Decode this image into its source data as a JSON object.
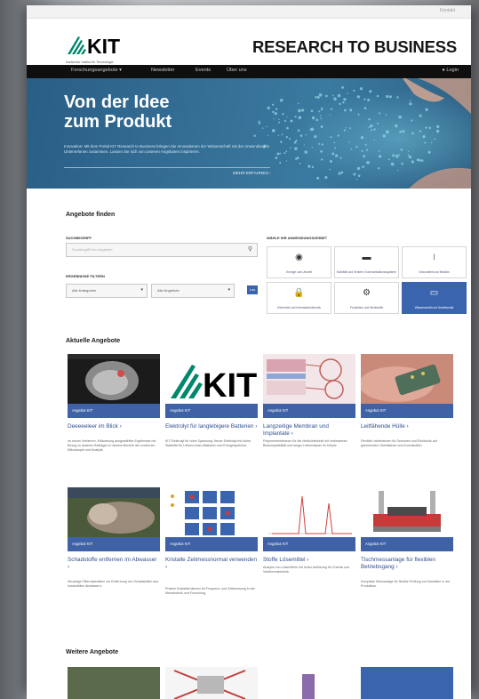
{
  "topbar": {
    "link": "Kontakt"
  },
  "header": {
    "logo_text": "KIT",
    "logo_sub": "Karlsruher Institut für Technologie",
    "site_title": "RESEARCH TO BUSINESS"
  },
  "nav": {
    "items": [
      "Forschungsangebote ▾",
      "Newsletter",
      "Events",
      "Über uns"
    ],
    "login": "Login"
  },
  "hero": {
    "heading_line1": "Von der Idee",
    "heading_line2": "zum Produkt",
    "text": "Innovation: Mit dem Portal KIT Research to Business bringen Sie Innovationen der Wissenschaft mit der Anwendung in Unternehmen zusammen. Lassen Sie sich von unseren Angeboten inspirieren.",
    "more": "MEHR ERFAHREN  ›"
  },
  "search": {
    "title": "Angebote finden",
    "keyword_label": "SUCHBEGRIFF",
    "keyword_placeholder": "Suchbegriff hier eingeben",
    "filter_label": "ERGEBNISSE FILTERN",
    "select1": "Alle Kategorien",
    "select2": "Alle Angebote",
    "go": "Los"
  },
  "areas": {
    "label": "WÄHLE IHR ANWENDUNGSGEBIET",
    "tiles": [
      {
        "icon": "globe-icon",
        "glyph": "◉",
        "label": "Energie und Umwelt",
        "active": false
      },
      {
        "icon": "car-icon",
        "glyph": "▬",
        "label": "Mobilität und Verkehr, Kommunikationssysteme",
        "active": false
      },
      {
        "icon": "dna-icon",
        "glyph": "⧘",
        "label": "Gesundheit und Medizin",
        "active": false
      },
      {
        "icon": "lock-icon",
        "glyph": "🔒",
        "label": "Sicherheit und Informationstechnik",
        "active": false
      },
      {
        "icon": "gears-icon",
        "glyph": "⚙",
        "label": "Produktion und Werkstoffe",
        "active": false
      },
      {
        "icon": "chat-icon",
        "glyph": "▭",
        "label": "Wissenschaft und Gesellschaft",
        "active": true
      }
    ]
  },
  "offers": {
    "title": "Aktuelle Angebote",
    "cards": [
      {
        "tag": "Angebot KIT",
        "title": "Deeeeeleer im Blick ›",
        "desc": "Im neuen Verfahren. Erläuterung ausgewählter Ergebnisse mit Bezug zu anderen Beiträgen in diesem Bereich der modernen Mikroskopie und Analytik."
      },
      {
        "tag": "Angebot KIT",
        "title": "Elektrolyt für langlebigere Batterien ›",
        "desc": "KIT Elektrolyt für hohe Spannung: Neuer Elektrolyt mit hoher Stabilität für Lithium-Ionen-Batterien und Energiespeicher."
      },
      {
        "tag": "Angebot KIT",
        "title": "Langzeitige Membran und Implantate ›",
        "desc": "Polymermembranen für die Medizintechnik mit verbesserter Biokompatibilität und langer Lebensdauer im Körper."
      },
      {
        "tag": "Angebot KIT",
        "title": "Leitfähende Hülle ›",
        "desc": "Flexible Leiterbahnen für Sensoren und Elektronik auf gekrümmten Oberflächen und Kunststoffen."
      },
      {
        "tag": "Angebot KIT",
        "title": "Schadstoffe entfernen im Abwasser ›",
        "desc": "Neuartige Filtermaterialien zur Entfernung von Schadstoffen aus industriellen Abwässern."
      },
      {
        "tag": "Angebot KIT",
        "title": "Kristalle Zeitmessnormal verwenden ›",
        "desc": "Präzise Kristallstrukturen für Frequenz- und Zeitmessung in der Messtechnik und Forschung."
      },
      {
        "tag": "Angebot KIT",
        "title": "Stoffe Lösemittel ›",
        "desc": "Analyse von Lösemitteln mit hoher Auflösung für Chemie und Verfahrenstechnik."
      },
      {
        "tag": "Angebot KIT",
        "title": "Tischmessanlage für flexiblen Betriebsgang ›",
        "desc": "Kompakte Messanlage für flexible Prüfung von Bauteilen in der Produktion."
      }
    ]
  },
  "more_offers": {
    "title": "Weitere Angebote"
  },
  "colors": {
    "accent": "#3f62a6",
    "nav_bg": "#0f0f0f",
    "hero_bg": "#356f96",
    "link": "#2f4f8c"
  }
}
